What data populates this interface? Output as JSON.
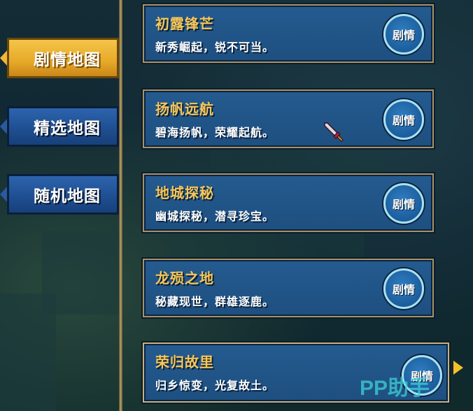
{
  "tabs": [
    {
      "label": "剧情地图",
      "state": "active"
    },
    {
      "label": "精选地图",
      "state": "inactive"
    },
    {
      "label": "随机地图",
      "state": "inactive"
    }
  ],
  "maps": [
    {
      "title": "初露锋芒",
      "desc": "新秀崛起，锐不可当。",
      "badge": "剧情"
    },
    {
      "title": "扬帆远航",
      "desc": "碧海扬帆，荣耀起航。",
      "badge": "剧情"
    },
    {
      "title": "地城探秘",
      "desc": "幽城探秘，潜寻珍宝。",
      "badge": "剧情"
    },
    {
      "title": "龙殒之地",
      "desc": "秘藏现世，群雄逐鹿。",
      "badge": "剧情"
    },
    {
      "title": "荣归故里",
      "desc": "归乡惊变，光复故土。",
      "badge": "剧情"
    }
  ],
  "watermark": "PP助手",
  "colors": {
    "tab_active": "#e7a928",
    "tab_inactive": "#1f4f92",
    "card_bg": "#1e4f80",
    "title": "#f6c75a",
    "badge_ring": "#a8e1f0"
  },
  "icons": {
    "cursor": "sword-cursor-icon",
    "next": "arrow-right-icon"
  }
}
